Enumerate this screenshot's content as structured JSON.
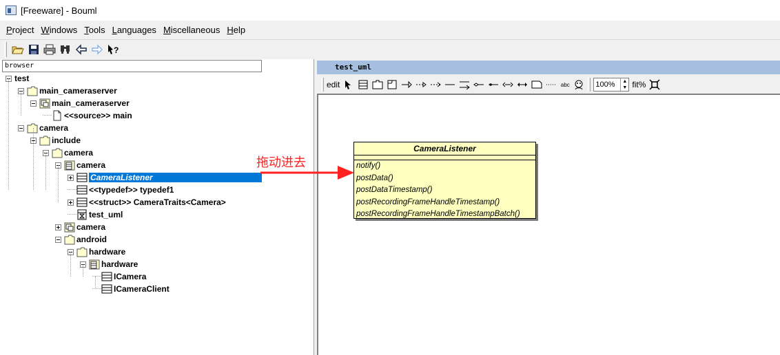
{
  "window": {
    "title": "[Freeware] - Bouml"
  },
  "menu": {
    "items": [
      {
        "first": "P",
        "rest": "roject"
      },
      {
        "first": "W",
        "rest": "indows"
      },
      {
        "first": "T",
        "rest": "ools"
      },
      {
        "first": "L",
        "rest": "anguages"
      },
      {
        "first": "M",
        "rest": "iscellaneous"
      },
      {
        "first": "H",
        "rest": "elp"
      }
    ]
  },
  "toolbar": {
    "icons": [
      "open-icon",
      "save-icon",
      "print-icon",
      "find-icon",
      "back-icon",
      "forward-icon",
      "whats-this-icon"
    ]
  },
  "browser": {
    "header": "browser",
    "tree": [
      {
        "label": "test",
        "icon": "none",
        "expander": "minus"
      },
      {
        "label": "main_cameraserver",
        "icon": "folder",
        "expander": "minus"
      },
      {
        "label": "main_cameraserver",
        "icon": "deployment-view",
        "expander": "minus"
      },
      {
        "label": "<<source>> main",
        "icon": "file",
        "expander": "none"
      },
      {
        "label": "camera",
        "icon": "folder",
        "expander": "minus"
      },
      {
        "label": "include",
        "icon": "folder",
        "expander": "minus"
      },
      {
        "label": "camera",
        "icon": "folder",
        "expander": "minus"
      },
      {
        "label": "camera",
        "icon": "class-view",
        "expander": "minus"
      },
      {
        "label": "CameraListener",
        "icon": "class",
        "expander": "plus",
        "selected": true
      },
      {
        "label": "<<typedef>> typedef1",
        "icon": "class",
        "expander": "none"
      },
      {
        "label": "<<struct>> CameraTraits<Camera>",
        "icon": "class",
        "expander": "plus"
      },
      {
        "label": "test_uml",
        "icon": "diagram",
        "expander": "none"
      },
      {
        "label": "camera",
        "icon": "deployment-view",
        "expander": "plus"
      },
      {
        "label": "android",
        "icon": "folder",
        "expander": "minus"
      },
      {
        "label": "hardware",
        "icon": "folder",
        "expander": "minus"
      },
      {
        "label": "hardware",
        "icon": "class-view",
        "expander": "minus"
      },
      {
        "label": "ICamera",
        "icon": "class",
        "expander": "none"
      },
      {
        "label": "ICameraClient",
        "icon": "class",
        "expander": "none"
      }
    ]
  },
  "diagram": {
    "tab_title": "test_uml",
    "toolbar": {
      "edit_label": "edit",
      "zoom_value": "100%",
      "fit_label": "fit%",
      "abc_label": "abc"
    },
    "class_box": {
      "name": "CameraListener",
      "operations": [
        "notify()",
        "postData()",
        "postDataTimestamp()",
        "postRecordingFrameHandleTimestamp()",
        "postRecordingFrameHandleTimestampBatch()"
      ],
      "fill_color": "#ffffc0"
    }
  },
  "annotation": {
    "text": "拖动进去",
    "color": "#ff2020"
  }
}
